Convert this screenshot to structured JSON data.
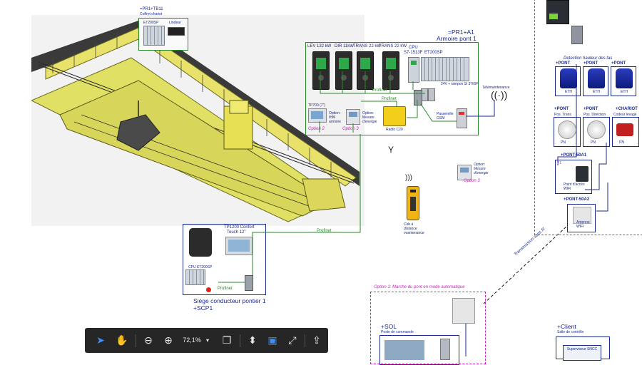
{
  "cabinet_tb11": {
    "title": "=PR1+TB11",
    "subtitle": "Coffret chariot",
    "module_label": "ET200SP",
    "display_label": "Lindear"
  },
  "cabinet_a1": {
    "title": "=PR1+A1",
    "subtitle": "Armoire pont 1",
    "drives": [
      "LEV 132 kW",
      "DIR 11kW",
      "TRANS 22 kW",
      "TRANS 22 kW"
    ],
    "cpu": "CPU",
    "cpu_model": "S7-1513F",
    "io": "ET200SP",
    "power": "24V + tampon Si 3°E9P",
    "profinet_1": "Profinet",
    "profinet_2": "Profinet",
    "hmi_label": "TP700 (7\")",
    "opt_hmi": "Option: IHM armoire",
    "opt_hmi_num": "Option 2",
    "opt_energy": "Option: Mesure d'energie",
    "opt_energy_num": "Option 3",
    "radio": "Radio C20",
    "gsm": "Passerelle GSM",
    "telemaint": "Télémaintenance"
  },
  "standalone_energy": {
    "text": "Option: Mesure d'energie",
    "option": "Option 3"
  },
  "remote": {
    "text": "Cde à distance maintenance"
  },
  "seat": {
    "hmi_title": "TP1200 Confort",
    "hmi_sub": "Touch 12\"",
    "cpu_label": "CPU ET200SP",
    "profinet": "Profinet",
    "profinet_main": "Profinet",
    "title": "Siège conducteur pontier 1",
    "code": "+SCP1"
  },
  "right": {
    "detect_title": "Detection hauteur des tas",
    "ponts": [
      "+PONT",
      "+PONT",
      "+PONT"
    ],
    "eth": "ETH",
    "trans": {
      "code": "+PONT",
      "label": "Pos. Trans"
    },
    "dir": {
      "code": "+PONT",
      "label": "Pos. Direction"
    },
    "chariot": {
      "code": "+CHARIOT",
      "label": "Codeur levage"
    },
    "pn": "PN",
    "a1": {
      "code": "+PONT-50A1",
      "p1": "P1",
      "label": "Point d'accès WIFI"
    },
    "a2": {
      "code": "+PONT-50A2",
      "label": "Antenne WIFI"
    }
  },
  "wifi_link": "Transmission sans fil",
  "option1": {
    "title": "Option 1: Marche du pont en mode automatique",
    "sol": "+SOL",
    "sol_sub": "Poste de commande"
  },
  "client": {
    "title": "+Client",
    "sub": "Salle de contrôle",
    "box": "Superviseur SNCC"
  },
  "toolbar": {
    "zoom": "72,1%"
  },
  "colors": {
    "green": "#2a8a2a",
    "blue": "#1a2a8e",
    "magenta": "#d020c0",
    "crane_yellow": "#e9e26a",
    "toolbar": "#262626"
  }
}
